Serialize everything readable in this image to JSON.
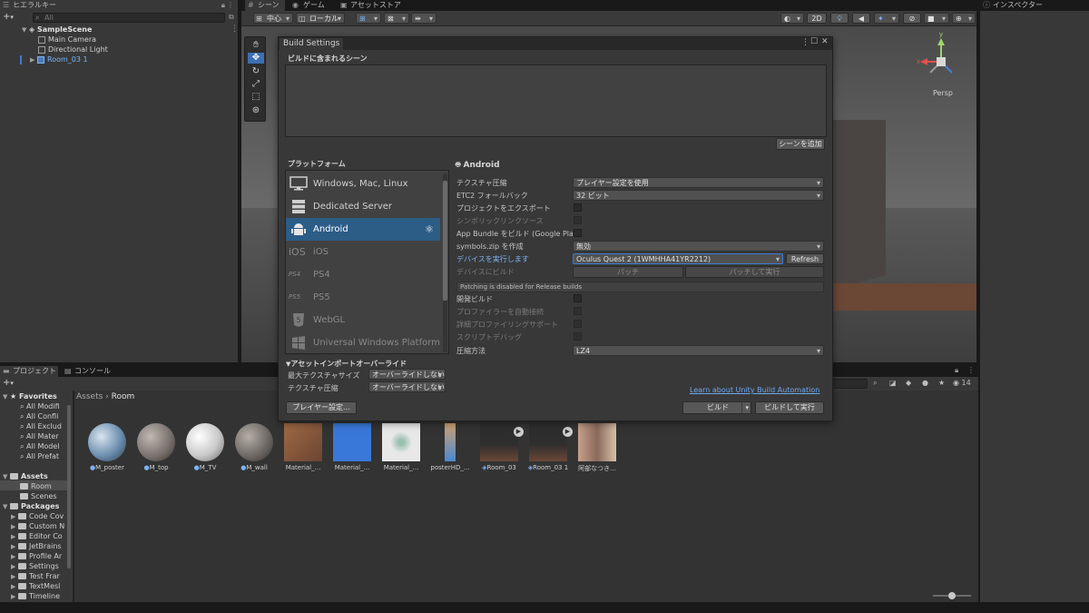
{
  "hierarchy": {
    "tab": "ヒエラルキー",
    "search_placeholder": "All",
    "add_label": "+",
    "items": [
      {
        "label": "SampleScene",
        "level": 0
      },
      {
        "label": "Main Camera",
        "level": 1
      },
      {
        "label": "Directional Light",
        "level": 1
      },
      {
        "label": "Room_03 1",
        "level": 1
      }
    ]
  },
  "scene_view": {
    "tabs": [
      "シーン",
      "ゲーム",
      "アセットストア"
    ],
    "pivot_label": "中心",
    "space_label": "ローカル",
    "mode_2d": "2D",
    "persp_label": "Persp"
  },
  "inspector": {
    "tab": "インスペクター"
  },
  "build_settings": {
    "title": "Build Settings",
    "scenes_header": "ビルドに含まれるシーン",
    "add_scene_button": "シーンを追加",
    "platform_header": "プラットフォーム",
    "platforms": [
      {
        "label": "Windows, Mac, Linux",
        "icon": "monitor-icon",
        "enabled": true
      },
      {
        "label": "Dedicated Server",
        "icon": "server-icon",
        "enabled": true
      },
      {
        "label": "Android",
        "icon": "android-icon",
        "enabled": true,
        "selected": true
      },
      {
        "label": "iOS",
        "icon": "ios-icon",
        "enabled": false
      },
      {
        "label": "PS4",
        "icon": "ps4-icon",
        "enabled": false
      },
      {
        "label": "PS5",
        "icon": "ps5-icon",
        "enabled": false
      },
      {
        "label": "WebGL",
        "icon": "html5-icon",
        "enabled": false
      },
      {
        "label": "Universal Windows Platform",
        "icon": "windows-icon",
        "enabled": false
      }
    ],
    "selected_platform": "Android",
    "settings": {
      "texture_compression_label": "テクスチャ圧縮",
      "texture_compression_value": "プレイヤー設定を使用",
      "etc2_fallback_label": "ETC2 フォールバック",
      "etc2_fallback_value": "32 ビット",
      "export_project_label": "プロジェクトをエクスポート",
      "symlink_sources_label": "シンボリックリンクソース",
      "app_bundle_label": "App Bundle をビルド (Google Play)",
      "symbols_zip_label": "symbols.zip を作成",
      "symbols_zip_value": "無効",
      "run_device_label": "デバイスを実行します",
      "run_device_value": "Oculus Quest 2 (1WMHHA41YR2212)",
      "refresh_button": "Refresh",
      "build_to_device_label": "デバイスにビルド",
      "patch_button": "パッチ",
      "patch_and_run_button": "パッチして実行",
      "patch_notice": "Patching is disabled for Release builds",
      "dev_build_label": "開発ビルド",
      "autoconnect_profiler_label": "プロファイラーを自動接続",
      "deep_profiling_label": "詳細プロファイリングサポート",
      "script_debugging_label": "スクリプトデバッグ",
      "compression_label": "圧縮方法",
      "compression_value": "LZ4"
    },
    "asset_import_overrides": {
      "header": "アセットインポートオーバーライド",
      "max_texture_size_label": "最大テクスチャサイズ",
      "max_texture_size_value": "オーバーライドしない",
      "texture_compression_label": "テクスチャ圧縮",
      "texture_compression_value": "オーバーライドしない"
    },
    "learn_link": "Learn about Unity Build Automation",
    "player_settings_button": "プレイヤー設定...",
    "build_button": "ビルド",
    "build_and_run_button": "ビルドして実行"
  },
  "project": {
    "tabs": [
      "プロジェクト",
      "コンソール"
    ],
    "add_label": "+",
    "breadcrumb": [
      "Assets",
      "Room"
    ],
    "hidden_count": "14",
    "favorites_header": "Favorites",
    "favorites": [
      "All Modifi",
      "All Confli",
      "All Exclud",
      "All Mater",
      "All Model",
      "All Prefat"
    ],
    "assets_header": "Assets",
    "assets_children": [
      "Room",
      "Scenes"
    ],
    "packages_header": "Packages",
    "packages": [
      "Code Cov",
      "Custom N",
      "Editor Co",
      "JetBrains",
      "Profile Ar",
      "Settings",
      "Test Frar",
      "TextMesl",
      "Timeline"
    ],
    "assets": [
      {
        "label": "M_poster",
        "kind": "material",
        "color": "#6d8fb0"
      },
      {
        "label": "M_top",
        "kind": "material",
        "color": "#7b7470"
      },
      {
        "label": "M_TV",
        "kind": "material",
        "color": "#c9c9c9"
      },
      {
        "label": "M_wall",
        "kind": "material",
        "color": "#6f6a66"
      },
      {
        "label": "Material_...",
        "kind": "texture",
        "color": "#8a5a3c"
      },
      {
        "label": "Material_...",
        "kind": "texture",
        "color": "#3a78d8"
      },
      {
        "label": "Material_...",
        "kind": "texture",
        "color": "#dcdcdc"
      },
      {
        "label": "posterHD_...",
        "kind": "texture",
        "color": "#d0a070"
      },
      {
        "label": "Room_03",
        "kind": "prefab",
        "color": "#4a3a34"
      },
      {
        "label": "Room_03 1",
        "kind": "prefab",
        "color": "#4a3a34"
      },
      {
        "label": "阿部なつき...",
        "kind": "texture",
        "color": "#b09080"
      }
    ]
  }
}
